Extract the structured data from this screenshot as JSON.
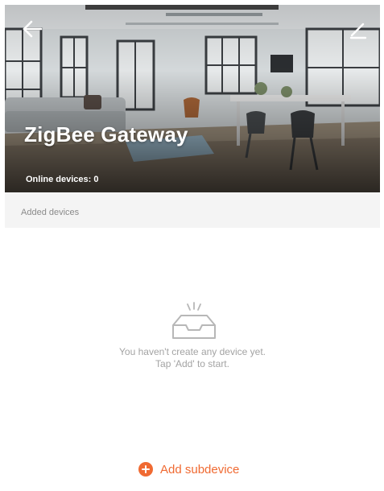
{
  "header": {
    "title": "ZigBee Gateway",
    "online_devices": "Online devices: 0",
    "back_icon": "arrow-left-icon",
    "edit_icon": "pencil-icon"
  },
  "section": {
    "label": "Added devices"
  },
  "empty_state": {
    "icon": "empty-tray-icon",
    "line1": "You haven't create any device yet.",
    "line2": "Tap 'Add' to start."
  },
  "footer": {
    "add_label": "Add subdevice",
    "add_icon": "plus-circle-icon"
  },
  "colors": {
    "accent": "#f06a32",
    "section_bg": "#f4f4f4",
    "muted_text": "#a3a3a3"
  }
}
